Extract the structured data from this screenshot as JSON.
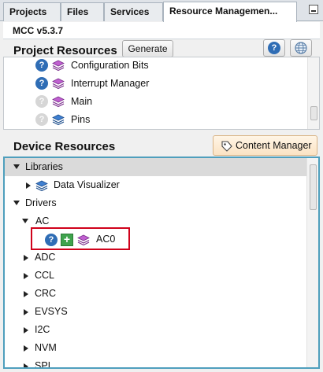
{
  "tabs": [
    {
      "label": "Projects",
      "active": false
    },
    {
      "label": "Files",
      "active": false
    },
    {
      "label": "Services",
      "active": false
    },
    {
      "label": "Resource Managemen...",
      "active": true
    }
  ],
  "version": "MCC v5.3.7",
  "project_resources": {
    "title": "Project Resources",
    "generate_label": "Generate",
    "items": [
      {
        "label": "Configuration Bits",
        "help_enabled": true,
        "icon": "layers-purple-icon"
      },
      {
        "label": "Interrupt Manager",
        "help_enabled": true,
        "icon": "layers-purple-icon"
      },
      {
        "label": "Main",
        "help_enabled": false,
        "icon": "layers-purple-icon"
      },
      {
        "label": "Pins",
        "help_enabled": false,
        "icon": "layers-blue-icon"
      }
    ]
  },
  "device_resources": {
    "title": "Device Resources",
    "content_manager_label": "Content Manager",
    "tree": {
      "libraries_label": "Libraries",
      "data_visualizer_label": "Data Visualizer",
      "drivers_label": "Drivers",
      "ac_label": "AC",
      "ac0_label": "AC0",
      "driver_items": [
        "ADC",
        "CCL",
        "CRC",
        "EVSYS",
        "I2C",
        "NVM",
        "SPI"
      ]
    }
  },
  "colors": {
    "accent_border": "#4f9fbd",
    "highlight": "#d0021b",
    "help_blue": "#2f6db5",
    "add_green": "#3fa34d"
  }
}
